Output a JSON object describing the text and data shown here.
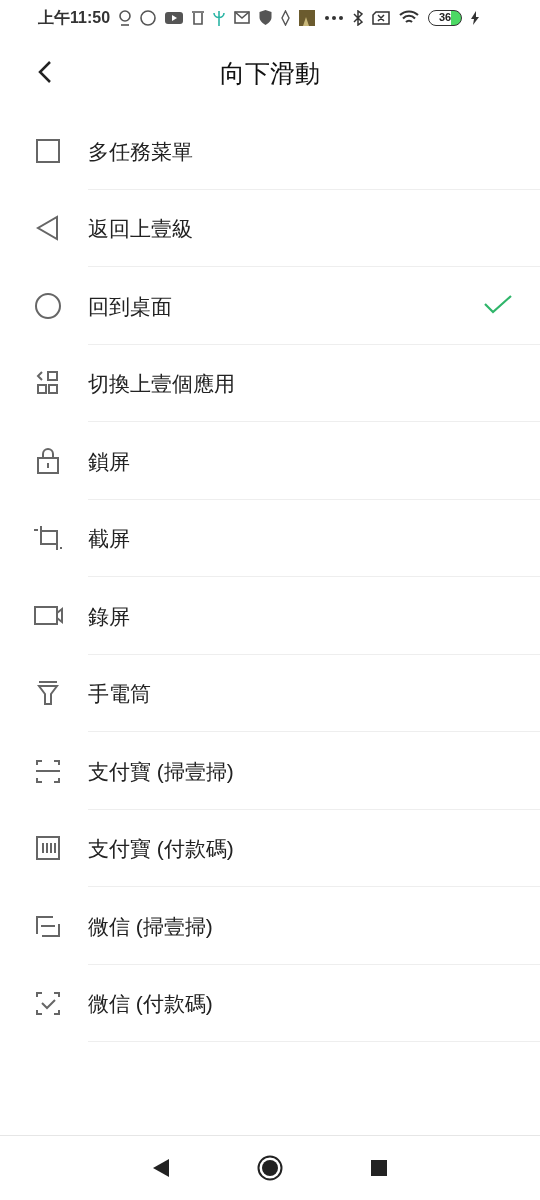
{
  "status_bar": {
    "time": "上午11:50",
    "battery": "36"
  },
  "header": {
    "title": "向下滑動"
  },
  "options": [
    {
      "kind": "recents",
      "label": "多任務菜單",
      "selected": false
    },
    {
      "kind": "back",
      "label": "返回上壹級",
      "selected": false
    },
    {
      "kind": "home",
      "label": "回到桌面",
      "selected": true
    },
    {
      "kind": "switch",
      "label": "切換上壹個應用",
      "selected": false
    },
    {
      "kind": "lock",
      "label": "鎖屏",
      "selected": false
    },
    {
      "kind": "screenshot",
      "label": "截屏",
      "selected": false
    },
    {
      "kind": "record",
      "label": "錄屏",
      "selected": false
    },
    {
      "kind": "flashlight",
      "label": "手電筒",
      "selected": false
    },
    {
      "kind": "scan",
      "label": "支付寶 (掃壹掃)",
      "selected": false
    },
    {
      "kind": "paycode",
      "label": "支付寶 (付款碼)",
      "selected": false
    },
    {
      "kind": "wscan",
      "label": "微信 (掃壹掃)",
      "selected": false
    },
    {
      "kind": "wpay",
      "label": "微信 (付款碼)",
      "selected": false
    }
  ]
}
